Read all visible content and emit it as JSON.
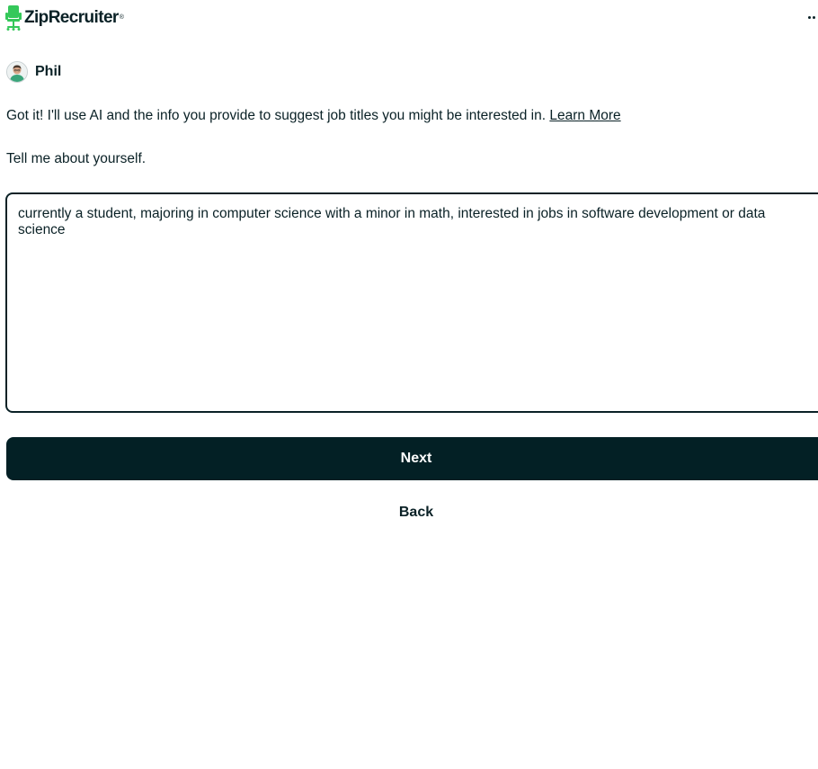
{
  "header": {
    "logo_text": "ZipRecruiter",
    "logo_mark": "®",
    "logo_icon": "chair-icon",
    "menu_icon": "more-dots-icon",
    "brand_color": "#35c85a"
  },
  "profile": {
    "name": "Phil",
    "avatar_icon": "user-avatar"
  },
  "chat": {
    "message": "Got it! I'll use AI and the info you provide to suggest job titles you might be interested in.",
    "learn_more_label": "Learn More",
    "prompt": "Tell me about yourself."
  },
  "form": {
    "about_value": "currently a student, majoring in computer science with a minor in math, interested in jobs in software development or data science",
    "next_label": "Next",
    "back_label": "Back",
    "primary_color": "#032025"
  }
}
